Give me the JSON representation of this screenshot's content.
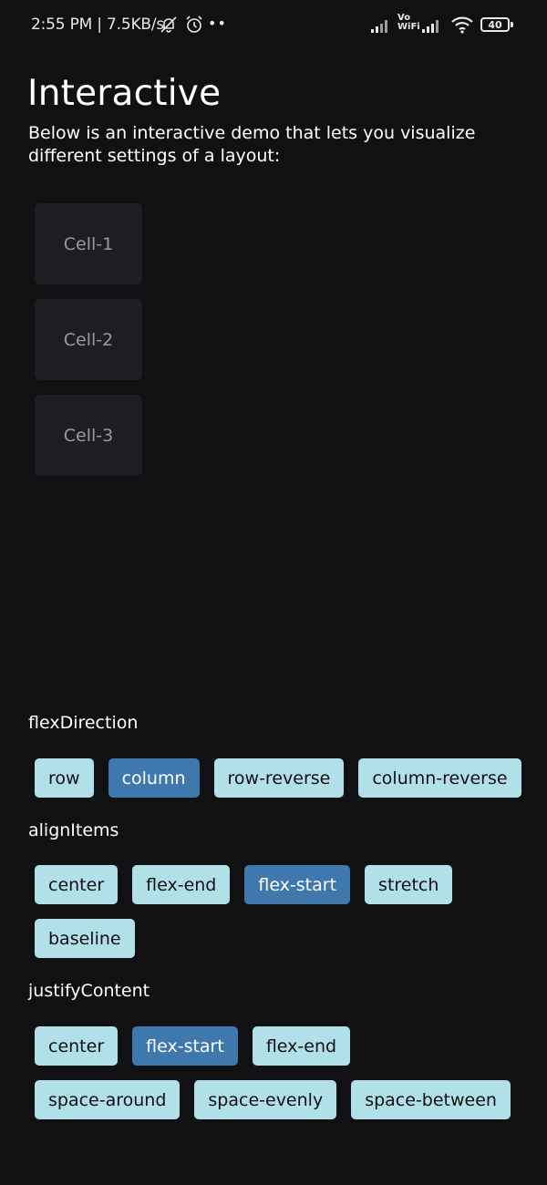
{
  "status_bar": {
    "time": "2:55 PM | 7.5KB/s",
    "vowifi_top": "Vo",
    "vowifi_bottom": "WiFi",
    "battery": "40",
    "icons": [
      "bell-off-icon",
      "alarm-icon",
      "more-dots-icon",
      "signal-icon",
      "vowifi-icon",
      "signal-icon",
      "wifi-icon",
      "battery-icon"
    ]
  },
  "header": {
    "title": "Interactive",
    "description": "Below is an interactive demo that lets you visualize different settings of a layout:"
  },
  "cells": [
    "Cell-1",
    "Cell-2",
    "Cell-3"
  ],
  "controls": {
    "flexDirection": {
      "label": "flexDirection",
      "options": [
        "row",
        "column",
        "row-reverse",
        "column-reverse"
      ],
      "selected": "column"
    },
    "alignItems": {
      "label": "alignItems",
      "options": [
        "center",
        "flex-end",
        "flex-start",
        "stretch",
        "baseline"
      ],
      "selected": "flex-start"
    },
    "justifyContent": {
      "label": "justifyContent",
      "options": [
        "center",
        "flex-start",
        "flex-end",
        "space-around",
        "space-evenly",
        "space-between"
      ],
      "selected": "flex-start"
    }
  },
  "colors": {
    "background": "#111013",
    "cell": "#1e1d21",
    "button": "#b1e0e8",
    "button_selected": "#3e78ad"
  }
}
